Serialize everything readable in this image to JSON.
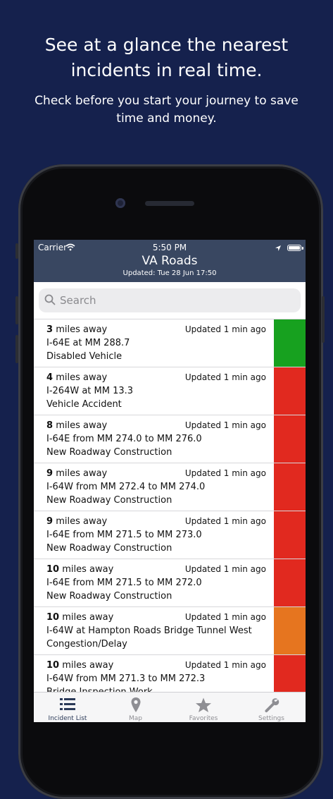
{
  "promo": {
    "headline_line1": "See at a glance the nearest",
    "headline_line2": "incidents in real time.",
    "subline_line1": "Check before you start your journey to save",
    "subline_line2": "time and money."
  },
  "status_bar": {
    "carrier": "Carrier",
    "time": "5:50 PM"
  },
  "nav": {
    "title": "VA Roads",
    "updated": "Updated: Tue 28 Jun 17:50"
  },
  "search": {
    "placeholder": "Search"
  },
  "colors": {
    "green": "#17a11f",
    "red": "#e1291f",
    "orange": "#e6751f",
    "nav_bg": "#394761",
    "page_bg": "#15214d"
  },
  "incidents": [
    {
      "miles": "3",
      "miles_suffix": "miles away",
      "updated": "Updated 1 min ago",
      "location": "I-64E at MM 288.7",
      "type": "Disabled Vehicle",
      "severity": "green"
    },
    {
      "miles": "4",
      "miles_suffix": "miles away",
      "updated": "Updated 1 min ago",
      "location": "I-264W at MM 13.3",
      "type": "Vehicle Accident",
      "severity": "red"
    },
    {
      "miles": "8",
      "miles_suffix": "miles away",
      "updated": "Updated 1 min ago",
      "location": "I-64E from MM 274.0 to MM 276.0",
      "type": "New Roadway Construction",
      "severity": "red"
    },
    {
      "miles": "9",
      "miles_suffix": "miles away",
      "updated": "Updated 1 min ago",
      "location": "I-64W from MM 272.4 to MM 274.0",
      "type": "New Roadway Construction",
      "severity": "red"
    },
    {
      "miles": "9",
      "miles_suffix": "miles away",
      "updated": "Updated 1 min ago",
      "location": "I-64E from MM 271.5 to MM 273.0",
      "type": "New Roadway Construction",
      "severity": "red"
    },
    {
      "miles": "10",
      "miles_suffix": "miles away",
      "updated": "Updated 1 min ago",
      "location": "I-64E from MM 271.5 to MM 272.0",
      "type": "New Roadway Construction",
      "severity": "red"
    },
    {
      "miles": "10",
      "miles_suffix": "miles away",
      "updated": "Updated 1 min ago",
      "location": "I-64W at Hampton Roads Bridge Tunnel West",
      "type": "Congestion/Delay",
      "severity": "orange"
    },
    {
      "miles": "10",
      "miles_suffix": "miles away",
      "updated": "Updated 1 min ago",
      "location": "I-64W from MM 271.3 to MM 272.3",
      "type": "Bridge Inspection Work",
      "severity": "red"
    }
  ],
  "tabs": [
    {
      "label": "Incident List",
      "icon": "list-icon",
      "active": true
    },
    {
      "label": "Map",
      "icon": "map-pin-icon",
      "active": false
    },
    {
      "label": "Favorites",
      "icon": "star-icon",
      "active": false
    },
    {
      "label": "Settings",
      "icon": "wrench-icon",
      "active": false
    }
  ]
}
